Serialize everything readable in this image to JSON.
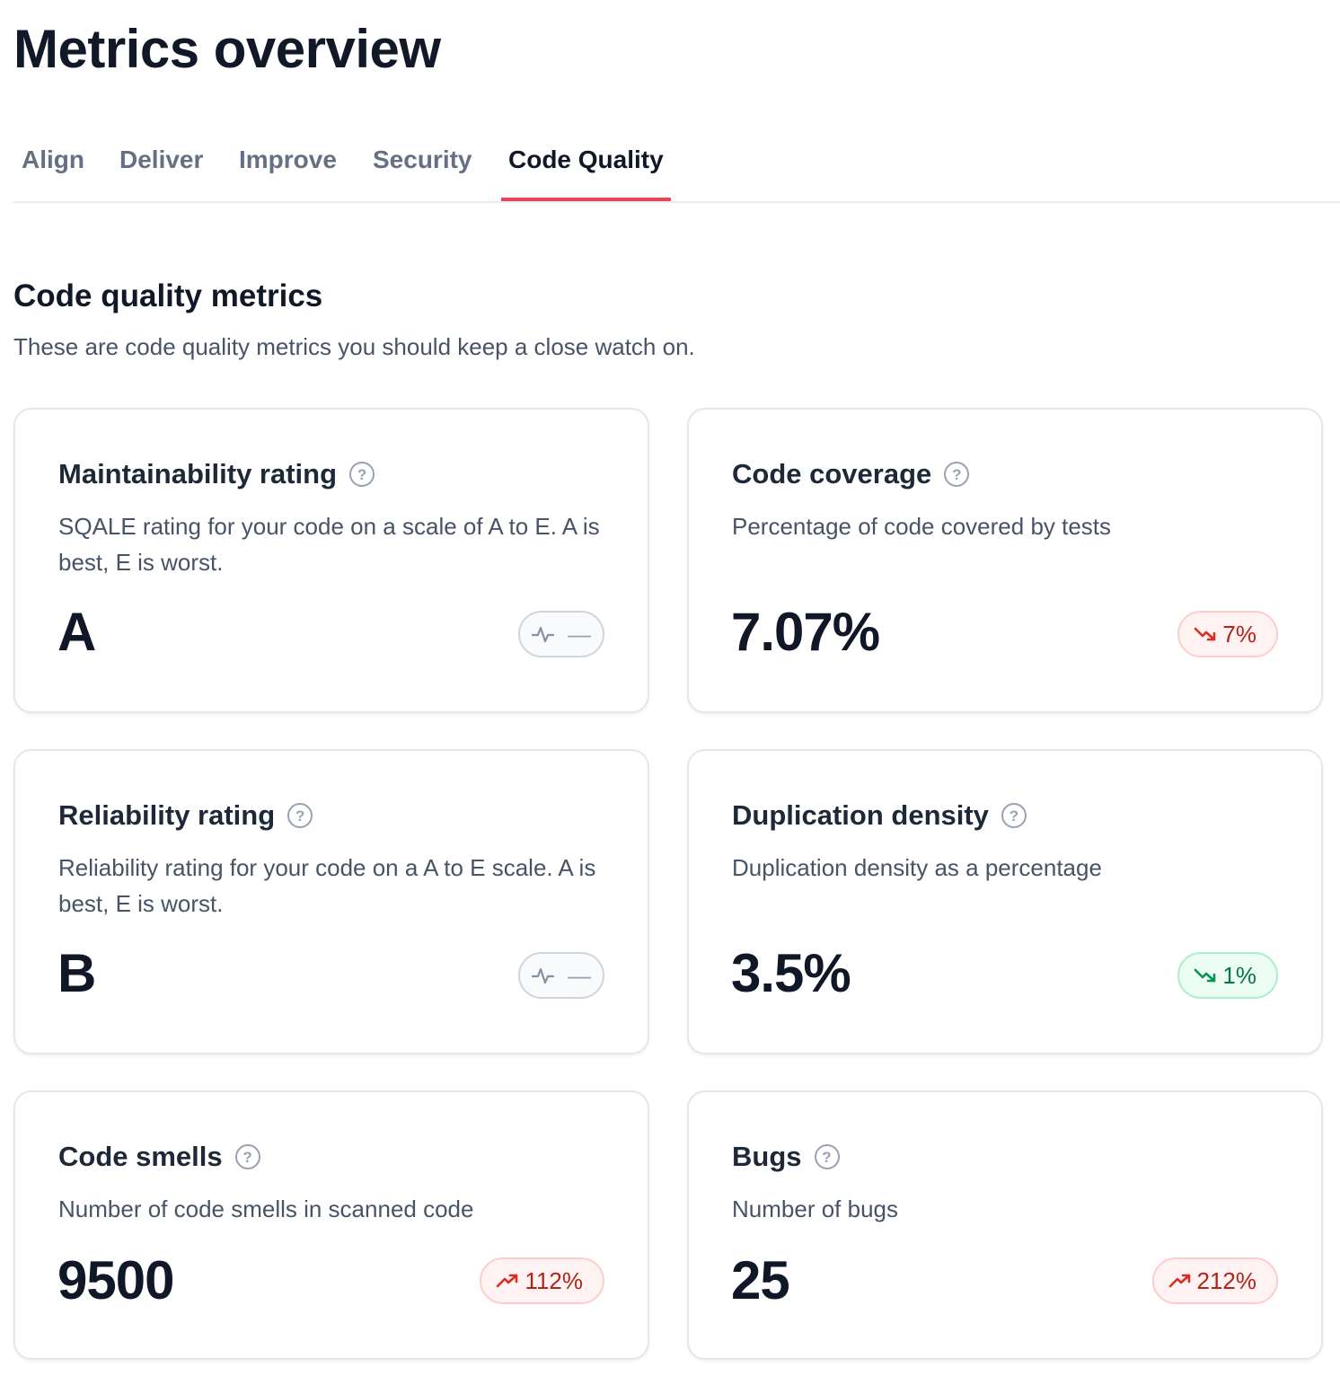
{
  "page": {
    "title": "Metrics overview"
  },
  "tabs": [
    {
      "label": "Align"
    },
    {
      "label": "Deliver"
    },
    {
      "label": "Improve"
    },
    {
      "label": "Security"
    },
    {
      "label": "Code Quality"
    }
  ],
  "active_tab": "Code Quality",
  "section": {
    "title": "Code quality metrics",
    "subtitle": "These are code quality metrics you should keep a close watch on."
  },
  "help_glyph": "?",
  "cards": [
    {
      "title": "Maintainability rating",
      "description": "SQALE rating for your code on a scale of A to E. A is best, E is worst.",
      "value": "A",
      "trend": {
        "kind": "neutral",
        "icon": "activity-icon",
        "text": "—"
      }
    },
    {
      "title": "Code coverage",
      "description": "Percentage of code covered by tests",
      "value": "7.07%",
      "trend": {
        "kind": "bad",
        "icon": "trend-down-icon",
        "text": "7%"
      }
    },
    {
      "title": "Reliability rating",
      "description": "Reliability rating for your code on a A to E scale. A is best, E is worst.",
      "value": "B",
      "trend": {
        "kind": "neutral",
        "icon": "activity-icon",
        "text": "—"
      }
    },
    {
      "title": "Duplication density",
      "description": "Duplication density as a percentage",
      "value": "3.5%",
      "trend": {
        "kind": "good",
        "icon": "trend-down-icon",
        "text": "1%"
      }
    },
    {
      "title": "Code smells",
      "description": "Number of code smells in scanned code",
      "value": "9500",
      "trend": {
        "kind": "bad",
        "icon": "trend-up-icon",
        "text": "112%"
      }
    },
    {
      "title": "Bugs",
      "description": "Number of bugs",
      "value": "25",
      "trend": {
        "kind": "bad",
        "icon": "trend-up-icon",
        "text": "212%"
      }
    }
  ],
  "colors": {
    "tab_underline": "#e5445a",
    "badge_bad": "#b42318",
    "badge_good": "#067647",
    "badge_neutral": "#98a2b3"
  }
}
